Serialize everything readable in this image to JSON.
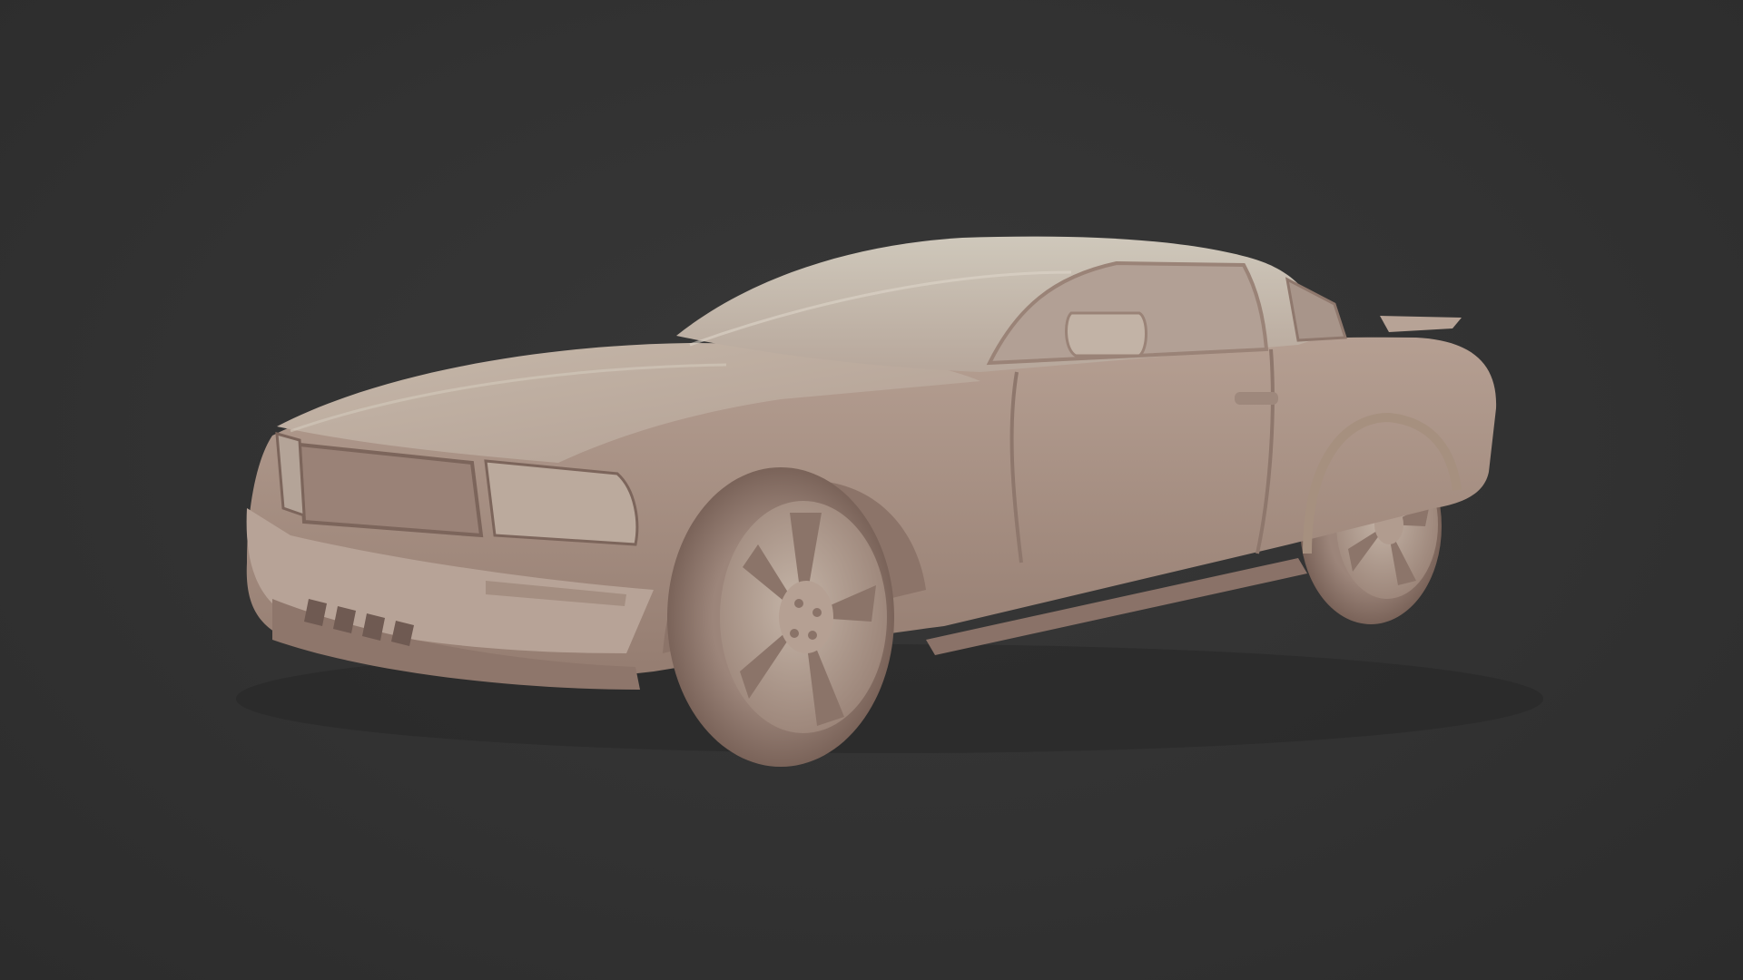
{
  "scene": {
    "subject_icon": "car-icon",
    "colors": {
      "background": "#313131",
      "clay_light": "#cfc6b8",
      "clay_mid": "#b39d90",
      "clay_dark": "#8a7268",
      "clay_shadow": "#5e4c46"
    }
  }
}
